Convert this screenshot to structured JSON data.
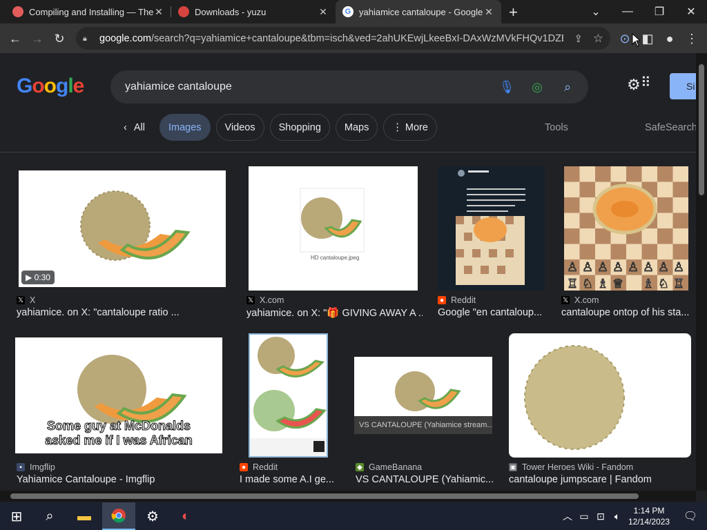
{
  "browser": {
    "tabs": [
      {
        "title": "Compiling and Installing — The I",
        "favicon": "#e25c5c",
        "active": false
      },
      {
        "title": "Downloads - yuzu",
        "favicon": "#3b4a9c",
        "active": false
      },
      {
        "title": "yahiamice cantaloupe - Google S",
        "favicon": "#ffffff",
        "active": true
      }
    ],
    "new_tab": "+",
    "url_domain": "google.com",
    "url_rest": "/search?q=yahiamice+cantaloupe&tbm=isch&ved=2ahUKEwjLkeeBxI-DAxWzMVkFHQv1DZEQ..."
  },
  "google": {
    "logo": "Google",
    "query": "yahiamice cantaloupe",
    "signin": "Si",
    "chips": [
      "All",
      "Images",
      "Videos",
      "Shopping",
      "Maps",
      "More"
    ],
    "tools": "Tools",
    "safesearch": "SafeSearch"
  },
  "results": [
    {
      "source": "X",
      "caption": "yahiamice. on X: \"cantaloupe ratio ...",
      "duration": "0:30"
    },
    {
      "source": "X.com",
      "caption": "yahiamice. on X: \"🎁 GIVING AWAY A ...",
      "img_label": "HD cantaloupe.jpeg"
    },
    {
      "source": "Reddit",
      "caption": "Google \"en cantaloup..."
    },
    {
      "source": "X.com",
      "caption": "cantaloupe ontop of his sta..."
    },
    {
      "source": "Imgflip",
      "caption": "Yahiamice Cantaloupe - Imgflip",
      "meme_line1": "Some guy at McDonalds",
      "meme_line2": "asked me if I was African"
    },
    {
      "source": "Reddit",
      "caption": "I made some A.I ge..."
    },
    {
      "source": "GameBanana",
      "caption": "VS CANTALOUPE (Yahiamic...",
      "img_label": "VS CANTALOUPE (Yahiamice stream..."
    },
    {
      "source": "Tower Heroes Wiki - Fandom",
      "caption": "cantaloupe jumpscare | Fandom"
    }
  ],
  "taskbar": {
    "time": "1:14 PM",
    "date": "12/14/2023"
  }
}
